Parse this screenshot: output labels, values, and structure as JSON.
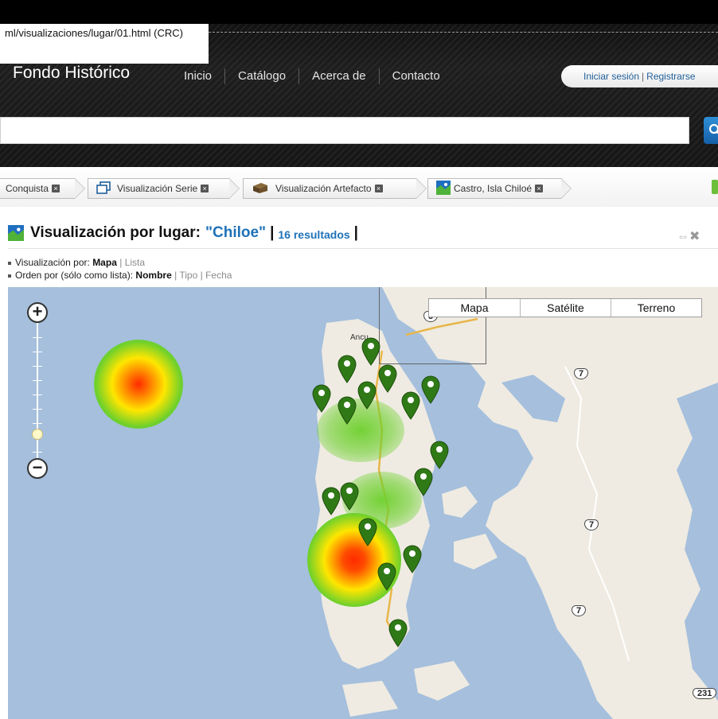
{
  "browser": {
    "url_tooltip": "ml/visualizaciones/lugar/01.html (CRC)"
  },
  "header": {
    "site_title": "Fondo Histórico",
    "nav": [
      "Inicio",
      "Catálogo",
      "Acerca de",
      "Contacto"
    ],
    "login": "Iniciar sesión",
    "register": "Registrarse",
    "search_value": "",
    "search_icon": "search-icon"
  },
  "breadcrumbs": [
    {
      "label": "Conquista",
      "icon": "none"
    },
    {
      "label": "Visualización Serie",
      "icon": "series-icon"
    },
    {
      "label": "Visualización Artefacto",
      "icon": "box-icon"
    },
    {
      "label": "Castro, Isla Chiloé",
      "icon": "map-place-icon"
    }
  ],
  "heading": {
    "prefix": "Visualización por lugar:",
    "query": "\"Chiloe\"",
    "pipe": "|",
    "count": "16 resultados",
    "pipe_end": "|"
  },
  "options": {
    "view_label": "Visualización por:",
    "view_active": "Mapa",
    "view_sep": "|",
    "view_other": "Lista",
    "order_label": "Orden por (sólo como lista):",
    "order_active": "Nombre",
    "order_sep1": "|",
    "order_opt2": "Tipo",
    "order_sep2": "|",
    "order_opt3": "Fecha"
  },
  "map": {
    "map_types": [
      "Mapa",
      "Satélite",
      "Terreno"
    ],
    "zoom_level_fraction": 0.25,
    "route_shields": [
      "5",
      "7",
      "7",
      "7",
      "231"
    ],
    "town_label": "Ancu",
    "marker_count": 16,
    "colors": {
      "water": "#a5bfdd",
      "land": "#efebe2",
      "marker": "#2f7a16",
      "heat_hot": "#ff2a00",
      "heat_mid": "#ffe600",
      "heat_cool": "#6dd02c"
    }
  }
}
